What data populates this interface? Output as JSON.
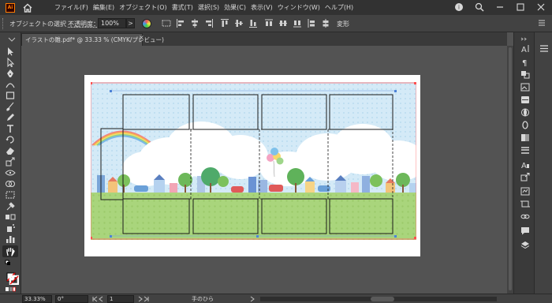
{
  "app": {
    "logo_text": "Ai",
    "accent": "#ff7c00"
  },
  "menubar": {
    "items": [
      "ファイル(F)",
      "編集(E)",
      "オブジェクト(O)",
      "書式(T)",
      "選択(S)",
      "効果(C)",
      "表示(V)",
      "ウィンドウ(W)",
      "ヘルプ(H)"
    ],
    "right_icons": [
      "help-icon",
      "search-icon",
      "minimize-icon",
      "restore-icon",
      "close-icon"
    ]
  },
  "controlbar": {
    "selection_state": "オブジェクトの選択",
    "opacity_label": "不透明度：",
    "opacity_value": "100%",
    "opacity_arrow": ">",
    "transform_label": "変形"
  },
  "document": {
    "tab_title": "イラストの雛.pdf* @ 33.33 % (CMYK/プレビュー)",
    "tab_close": "×"
  },
  "statusbar": {
    "zoom": "33.33%",
    "rotation": "0°",
    "artboard_number": "1",
    "status_text": "手のひら"
  },
  "colors": {
    "ui_dark": "#323232",
    "ui_panel": "#424242",
    "canvas": "#535353",
    "sky": "#cfe6f5",
    "grass": "#a8d27a",
    "guide_red": "#ff5050",
    "guide_blue": "#4a7fd6"
  }
}
